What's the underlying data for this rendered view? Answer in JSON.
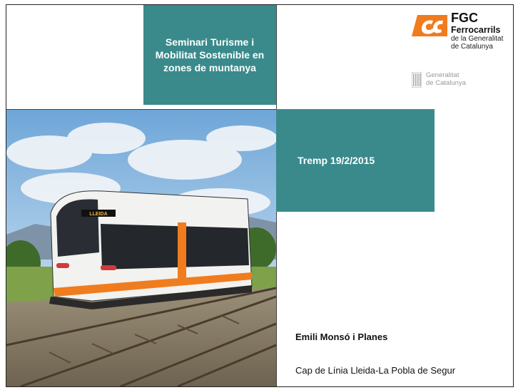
{
  "title": "Seminari Turisme i Mobilitat Sostenible en zones de muntanya",
  "date": "Tremp 19/2/2015",
  "author": "Emili Monsó i Planes",
  "role": "Cap de Línia Lleida-La Pobla de Segur",
  "fgc_logo": {
    "name": "FGC",
    "line1": "Ferrocarrils",
    "line2": "de la Generalitat",
    "line3": "de Catalunya",
    "color": "#f07c1e"
  },
  "generalitat_logo": {
    "line1": "Generalitat",
    "line2": "de Catalunya"
  },
  "photo": {
    "destination_sign": "LLEIDA"
  },
  "colors": {
    "teal": "#3a8a8c",
    "orange": "#f07c1e"
  }
}
